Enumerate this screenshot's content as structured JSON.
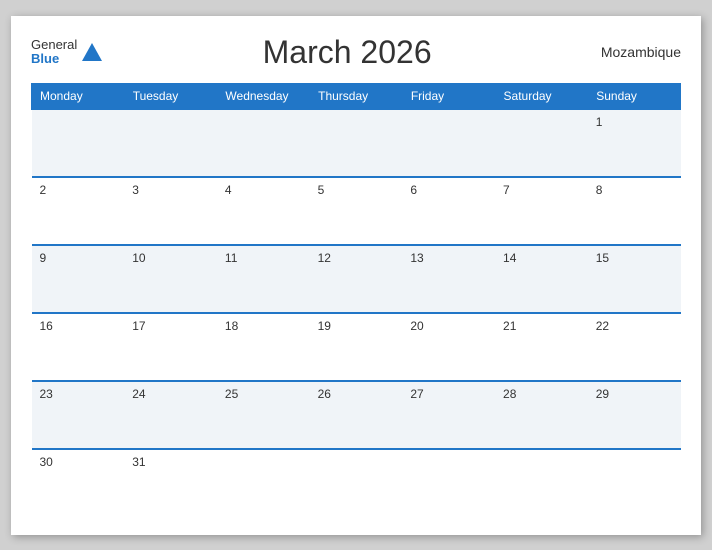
{
  "header": {
    "logo_general": "General",
    "logo_blue": "Blue",
    "title": "March 2026",
    "country": "Mozambique"
  },
  "weekdays": [
    "Monday",
    "Tuesday",
    "Wednesday",
    "Thursday",
    "Friday",
    "Saturday",
    "Sunday"
  ],
  "weeks": [
    [
      null,
      null,
      null,
      null,
      null,
      null,
      "1"
    ],
    [
      "2",
      "3",
      "4",
      "5",
      "6",
      "7",
      "8"
    ],
    [
      "9",
      "10",
      "11",
      "12",
      "13",
      "14",
      "15"
    ],
    [
      "16",
      "17",
      "18",
      "19",
      "20",
      "21",
      "22"
    ],
    [
      "23",
      "24",
      "25",
      "26",
      "27",
      "28",
      "29"
    ],
    [
      "30",
      "31",
      null,
      null,
      null,
      null,
      null
    ]
  ]
}
